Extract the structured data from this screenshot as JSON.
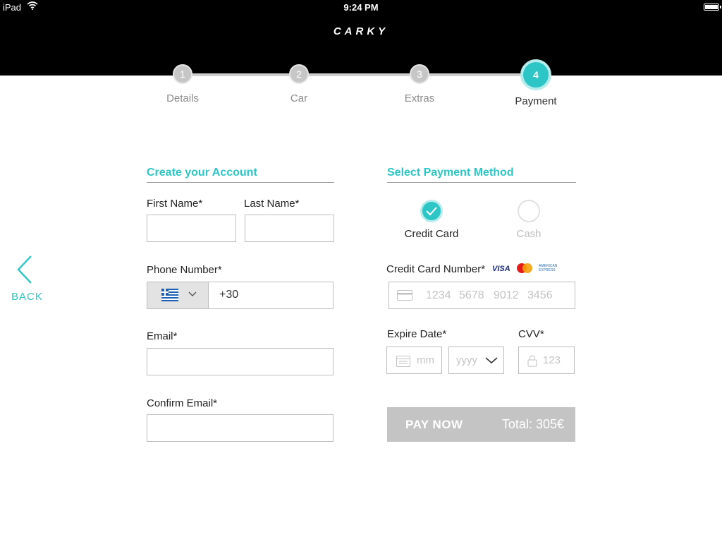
{
  "status_bar": {
    "carrier": "iPad",
    "time": "9:24 PM"
  },
  "header": {
    "logo": "CARKY"
  },
  "steps": [
    {
      "number": "1",
      "label": "Details"
    },
    {
      "number": "2",
      "label": "Car"
    },
    {
      "number": "3",
      "label": "Extras"
    },
    {
      "number": "4",
      "label": "Payment"
    }
  ],
  "nav": {
    "back_label": "BACK"
  },
  "account": {
    "title": "Create your Account",
    "first_name_label": "First Name*",
    "last_name_label": "Last Name*",
    "phone_label": "Phone Number*",
    "phone_code": "+30",
    "email_label": "Email*",
    "confirm_email_label": "Confirm Email*"
  },
  "payment": {
    "title": "Select Payment Method",
    "methods": [
      {
        "label": "Credit Card",
        "selected": true
      },
      {
        "label": "Cash",
        "selected": false
      }
    ],
    "card_number_label": "Credit Card Number*",
    "card_brands": [
      "VISA",
      "MasterCard",
      "AMERICAN EXPRESS"
    ],
    "card_placeholder_groups": [
      "1234",
      "5678",
      "9012",
      "3456"
    ],
    "expire_label": "Expire Date*",
    "month_placeholder": "mm",
    "year_placeholder": "yyyy",
    "cvv_label": "CVV*",
    "cvv_placeholder": "123",
    "pay_label": "PAY NOW",
    "total": "Total: 305€"
  },
  "colors": {
    "accent": "#2ec5c6",
    "header_bg": "#000000",
    "pay_button_bg": "#c4c4c4"
  }
}
